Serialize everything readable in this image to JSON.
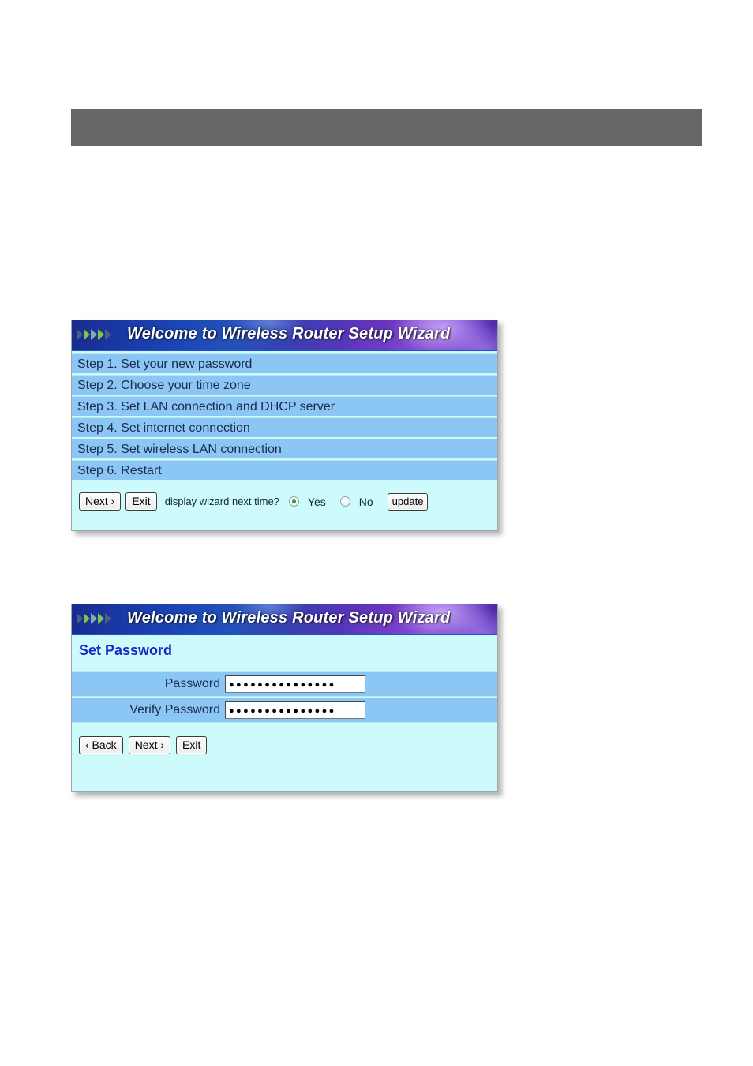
{
  "page": {
    "background": "#ffffff",
    "header_band_color": "#666666"
  },
  "wizard_banner": {
    "title": "Welcome to Wireless Router Setup Wizard",
    "chevron_icon": "double-chevron-right",
    "chevron_count": 5
  },
  "panel_welcome": {
    "steps": [
      "Step 1. Set your new password",
      "Step 2. Choose your time zone",
      "Step 3. Set LAN connection and DHCP server",
      "Step 4. Set internet connection",
      "Step 5. Set wireless LAN connection",
      "Step 6. Restart"
    ],
    "buttons": {
      "next": "Next ›",
      "exit": "Exit",
      "update": "update"
    },
    "prompt": "display wizard next time?",
    "radios": [
      {
        "label": "Yes",
        "selected": true
      },
      {
        "label": "No",
        "selected": false
      }
    ],
    "radio_selected_color": "#2f9e2f"
  },
  "panel_password": {
    "section_title": "Set Password",
    "fields": [
      {
        "label": "Password",
        "value": "●●●●●●●●●●●●●●●",
        "type": "password"
      },
      {
        "label": "Verify Password",
        "value": "●●●●●●●●●●●●●●●",
        "type": "password"
      }
    ],
    "buttons": {
      "back": "‹ Back",
      "next": "Next ›",
      "exit": "Exit"
    }
  },
  "colors": {
    "row_blue": "#8cc6f5",
    "panel_bg": "#cdfbfb",
    "title_blue": "#1a28c8"
  }
}
